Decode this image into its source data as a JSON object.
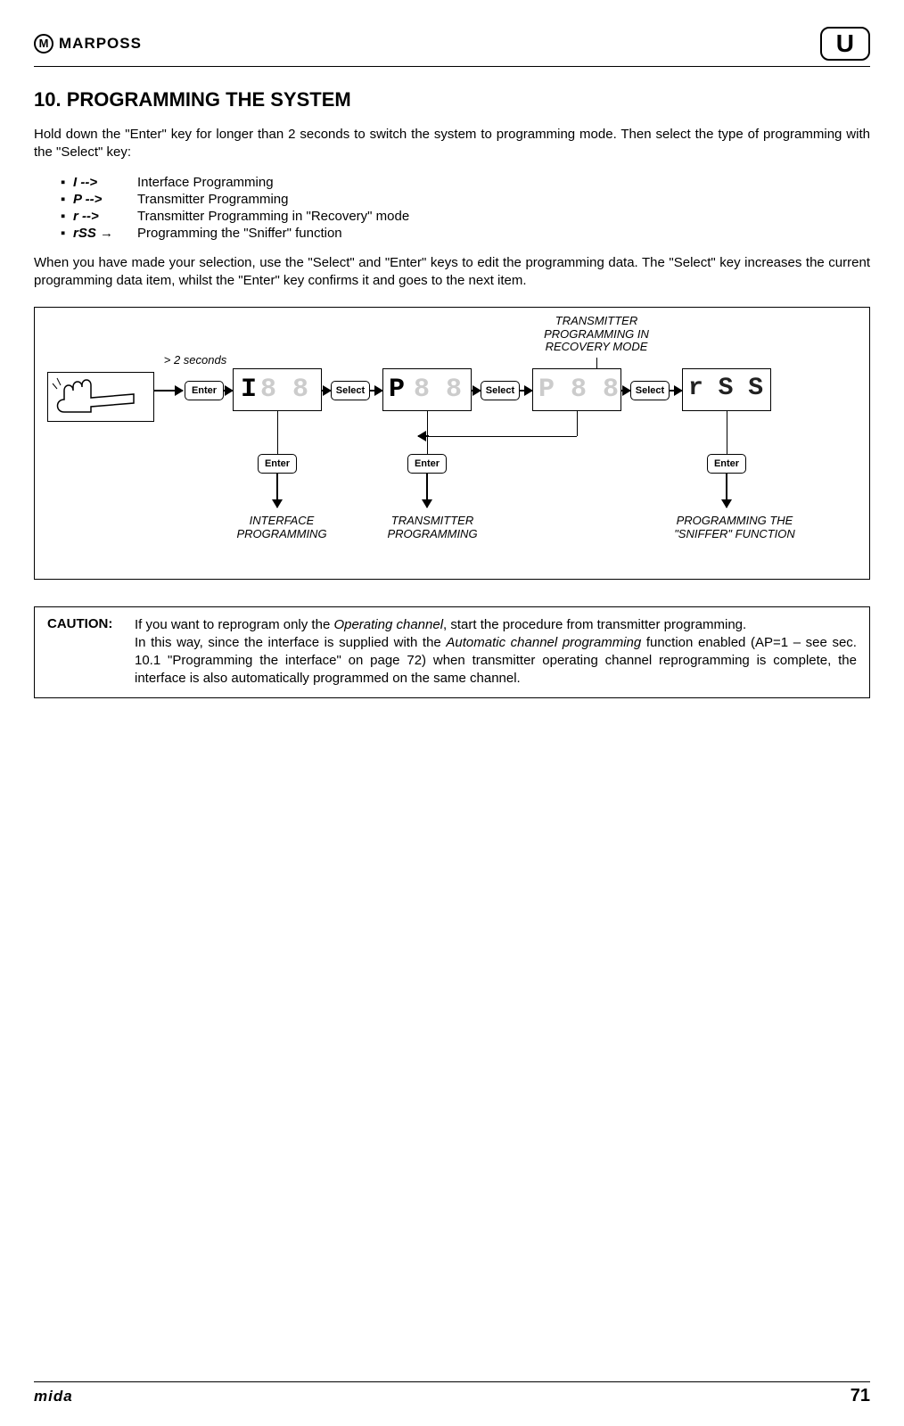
{
  "header": {
    "logo_letter": "M",
    "brand": "MARPOSS",
    "u": "U"
  },
  "title": "10. PROGRAMMING THE SYSTEM",
  "intro": "Hold down the \"Enter\" key for longer than 2 seconds to switch the system to programming mode. Then select the type of programming with the \"Select\" key:",
  "codes": [
    {
      "c": "I  -->",
      "d": "Interface Programming"
    },
    {
      "c": "P  -->",
      "d": "Transmitter Programming"
    },
    {
      "c": "r  -->",
      "d": "Transmitter Programming in \"Recovery\" mode"
    },
    {
      "c": "rSS →",
      "d": "Programming the \"Sniffer\" function"
    }
  ],
  "para2": "When you have made your selection, use the \"Select\" and \"Enter\" keys to edit the programming data. The \"Select\" key increases the current programming data item, whilst the \"Enter\" key confirms it and goes to the next item.",
  "diagram": {
    "gt2s": "> 2 seconds",
    "enter": "Enter",
    "select": "Select",
    "disp1": "I 8 8",
    "disp2": "P 8 8",
    "disp3": "P 8 8",
    "disp4": "r S S",
    "lab_top": "TRANSMITTER PROGRAMMING IN RECOVERY MODE",
    "lab1": "INTERFACE PROGRAMMING",
    "lab2": "TRANSMITTER PROGRAMMING",
    "lab3": "PROGRAMMING THE \"SNIFFER\" FUNCTION"
  },
  "caution": {
    "label": "CAUTION:",
    "l1a": "If you want to reprogram only the ",
    "l1b": "Operating channel",
    "l1c": ", start the procedure from transmitter programming.",
    "l2a": "In this way, since the interface is supplied with the ",
    "l2b": "Automatic channel programming",
    "l2c": " function enabled (AP=1 – see sec. 10.1 \"Programming the interface\" on page 72) when transmitter operating channel reprogramming is complete, the interface is also automatically programmed on the same channel."
  },
  "footer": {
    "brand": "mida",
    "page": "71"
  }
}
